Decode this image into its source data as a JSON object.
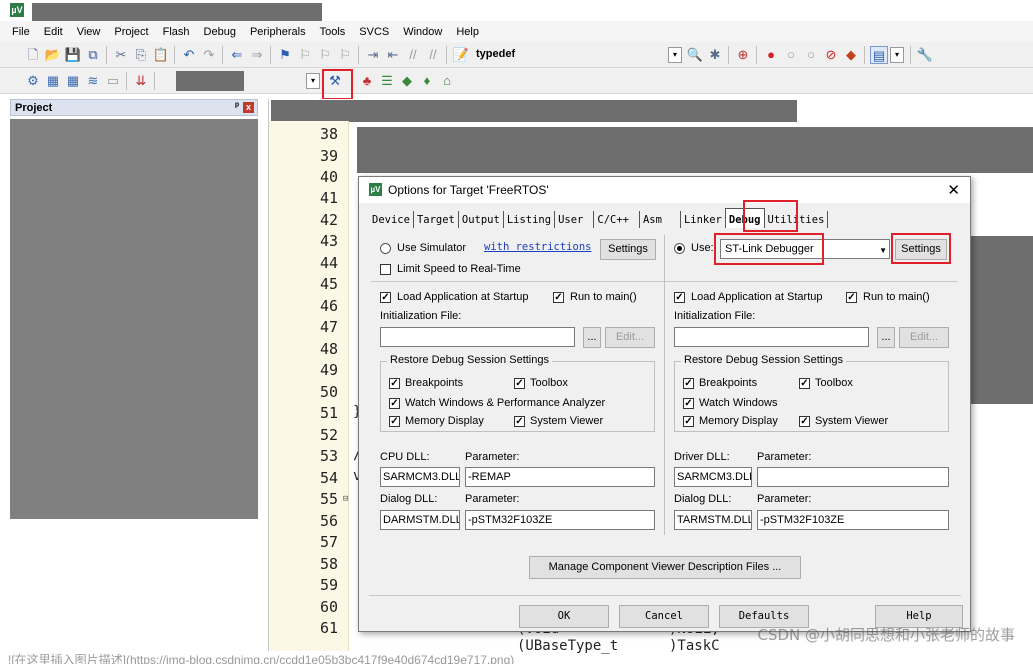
{
  "app": {
    "logo": "µV"
  },
  "menu": [
    "File",
    "Edit",
    "View",
    "Project",
    "Flash",
    "Debug",
    "Peripherals",
    "Tools",
    "SVCS",
    "Window",
    "Help"
  ],
  "toolbar1": {
    "find_text": "typedef"
  },
  "project_panel": {
    "title": "Project",
    "pin": "ᵖ",
    "close": "x"
  },
  "editor": {
    "line_numbers": [
      "38",
      "39",
      "40",
      "41",
      "42",
      "43",
      "44",
      "45",
      "46",
      "47",
      "48",
      "49",
      "50",
      "51",
      "52",
      "53",
      "54",
      "55",
      "56",
      "57",
      "58",
      "59",
      "60",
      "61"
    ],
    "fragments": {
      "line51": "}",
      "line53": "/",
      "line54": "v",
      "line61a": "(Void",
      "line61b": "(UBaseType_t",
      "line61c": ")NULL,",
      "line61d": ")TaskC"
    },
    "fold_marker": "⊟"
  },
  "dialog": {
    "title": "Options for Target 'FreeRTOS'",
    "close": "✕",
    "tabs": [
      "Device",
      "Target",
      "Output",
      "Listing",
      "User",
      "C/C++",
      "Asm",
      "Linker",
      "Debug",
      "Utilities"
    ],
    "active_tab": "Debug",
    "left": {
      "use_simulator": "Use Simulator",
      "with_restrictions": "with restrictions",
      "settings": "Settings",
      "limit_speed": "Limit Speed to Real-Time",
      "load_app": "Load Application at Startup",
      "run_to_main": "Run to main()",
      "init_file": "Initialization File:",
      "browse": "...",
      "edit": "Edit...",
      "restore_group": "Restore Debug Session Settings",
      "breakpoints": "Breakpoints",
      "toolbox": "Toolbox",
      "watch_windows": "Watch Windows & Performance Analyzer",
      "memory_display": "Memory Display",
      "system_viewer": "System Viewer",
      "cpu_dll_label": "CPU DLL:",
      "parameter_label": "Parameter:",
      "cpu_dll": "SARMCM3.DLL",
      "cpu_param": "-REMAP",
      "dialog_dll_label": "Dialog DLL:",
      "dialog_dll": "DARMSTM.DLL",
      "dialog_param": "-pSTM32F103ZE"
    },
    "right": {
      "use": "Use:",
      "debugger": "ST-Link Debugger",
      "settings": "Settings",
      "load_app": "Load Application at Startup",
      "run_to_main": "Run to main()",
      "init_file": "Initialization File:",
      "browse": "...",
      "edit": "Edit...",
      "restore_group": "Restore Debug Session Settings",
      "breakpoints": "Breakpoints",
      "toolbox": "Toolbox",
      "watch_windows": "Watch Windows",
      "memory_display": "Memory Display",
      "system_viewer": "System Viewer",
      "driver_dll_label": "Driver DLL:",
      "parameter_label": "Parameter:",
      "driver_dll": "SARMCM3.DLL",
      "driver_param": "",
      "dialog_dll_label": "Dialog DLL:",
      "dialog_dll": "TARMSTM.DLL",
      "dialog_param": "-pSTM32F103ZE"
    },
    "manage_button": "Manage Component Viewer Description Files ...",
    "ok": "OK",
    "cancel": "Cancel",
    "defaults": "Defaults",
    "help": "Help"
  },
  "caption": "![在这里插入图片描述](https://img-blog.csdnimg.cn/ccdd1e05b3bc417f9e40d674cd19e717.png)",
  "watermark": "CSDN @小胡同思想和小张老师的故事",
  "colors": {
    "highlight": "#e0202a",
    "redaction": "#6e6e6e"
  }
}
